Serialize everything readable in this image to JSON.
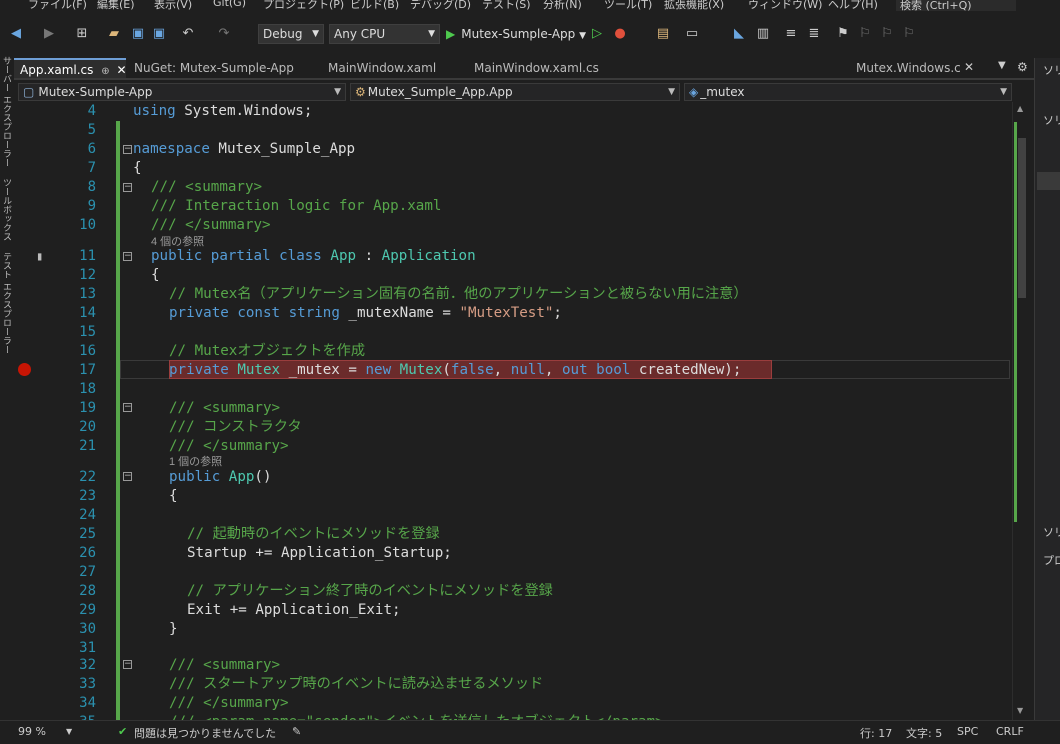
{
  "menu": [
    "ファイル(F)",
    "編集(E)",
    "表示(V)",
    "Git(G)",
    "プロジェクト(P)",
    "ビルド(B)",
    "デバッグ(D)",
    "テスト(S)",
    "分析(N)",
    "ツール(T)",
    "拡張機能(X)",
    "ウィンドウ(W)",
    "ヘルプ(H)"
  ],
  "search_placeholder": "検索 (Ctrl+Q)",
  "toolbar": {
    "config": "Debug",
    "platform": "Any CPU",
    "run_target": "Mutex-Sumple-App"
  },
  "side_panels": [
    "サーバー エクスプローラー",
    "ツールボックス",
    "テスト エクスプローラー"
  ],
  "tabs": [
    {
      "label": "App.xaml.cs",
      "pin": "ᵠ",
      "active": true
    },
    {
      "label": "NuGet: Mutex-Sumple-App",
      "active": false
    },
    {
      "label": "MainWindow.xaml",
      "active": false
    },
    {
      "label": "MainWindow.xaml.cs",
      "active": false
    },
    {
      "label": "Mutex.Windows.cs",
      "active": false
    }
  ],
  "nav": {
    "project": "Mutex-Sumple-App",
    "class": "Mutex_Sumple_App.App",
    "member": "_mutex"
  },
  "code_lines": [
    {
      "n": "4",
      "t": "using System.Windows;"
    },
    {
      "n": "5",
      "t": ""
    },
    {
      "n": "6",
      "t": "namespace Mutex_Sumple_App"
    },
    {
      "n": "7",
      "t": "{"
    },
    {
      "n": "8",
      "t": "/// <summary>"
    },
    {
      "n": "9",
      "t": "/// Interaction logic for App.xaml"
    },
    {
      "n": "10",
      "t": "/// </summary>"
    },
    {
      "n": "11",
      "t": "public partial class App : Application"
    },
    {
      "n": "12",
      "t": "{"
    },
    {
      "n": "13",
      "t": "// Mutex名（アプリケーション固有の名前．他のアプリケーションと被らない用に注意）"
    },
    {
      "n": "14",
      "t": "private const string _mutexName = \"MutexTest\";"
    },
    {
      "n": "15",
      "t": ""
    },
    {
      "n": "16",
      "t": "// Mutexオブジェクトを作成"
    },
    {
      "n": "17",
      "t": "private Mutex _mutex = new Mutex(false, null, out bool createdNew);"
    },
    {
      "n": "18",
      "t": ""
    },
    {
      "n": "19",
      "t": "/// <summary>"
    },
    {
      "n": "20",
      "t": "/// コンストラクタ"
    },
    {
      "n": "21",
      "t": "/// </summary>"
    },
    {
      "n": "22",
      "t": "public App()"
    },
    {
      "n": "23",
      "t": "{"
    },
    {
      "n": "24",
      "t": ""
    },
    {
      "n": "25",
      "t": "// 起動時のイベントにメソッドを登録"
    },
    {
      "n": "26",
      "t": "Startup += Application_Startup;"
    },
    {
      "n": "27",
      "t": ""
    },
    {
      "n": "28",
      "t": "// アプリケーション終了時のイベントにメソッドを登録"
    },
    {
      "n": "29",
      "t": "Exit += Application_Exit;"
    },
    {
      "n": "30",
      "t": "}"
    },
    {
      "n": "31",
      "t": ""
    },
    {
      "n": "32",
      "t": "/// <summary>"
    },
    {
      "n": "33",
      "t": "/// スタートアップ時のイベントに読み込ませるメソッド"
    },
    {
      "n": "34",
      "t": "/// </summary>"
    },
    {
      "n": "35",
      "t": "/// <param name=\"sender\">イベントを送信したオブジェクト</param>"
    }
  ],
  "codelens": {
    "class_refs": "4 個の参照",
    "ctor_refs": "1 個の参照"
  },
  "right_panel": [
    "ソリ",
    "ソリ",
    "ソリ",
    "プロ"
  ],
  "status": {
    "zoom": "99 %",
    "issues": "問題は見つかりませんでした",
    "line": "行: 17",
    "col": "文字: 5",
    "spc": "SPC",
    "eol": "CRLF"
  },
  "colors": {
    "keyword": "#569cd6",
    "type": "#4ec9b0",
    "comment": "#57a64a",
    "string": "#d69d85",
    "breakpoint": "#e51400"
  }
}
